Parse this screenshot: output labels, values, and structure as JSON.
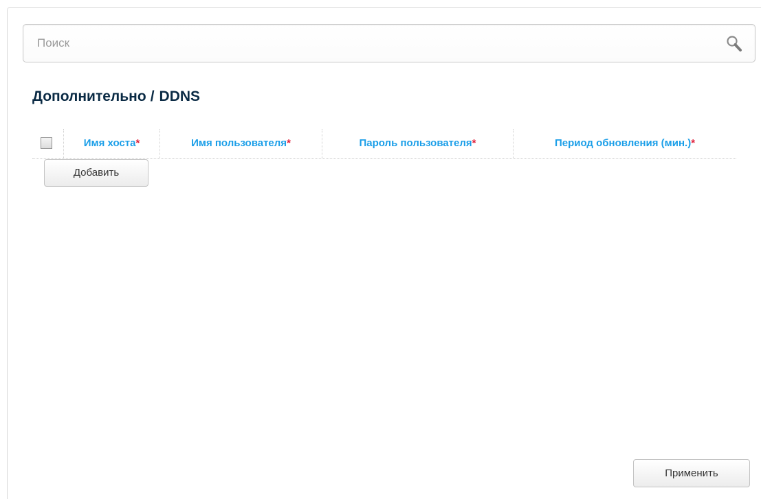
{
  "search": {
    "placeholder": "Поиск",
    "value": ""
  },
  "page": {
    "breadcrumb_parent": "Дополнительно",
    "separator": "/",
    "title": "DDNS"
  },
  "table": {
    "columns": [
      {
        "label": "Имя хоста",
        "required_mark": "*"
      },
      {
        "label": "Имя пользователя",
        "required_mark": "*"
      },
      {
        "label": "Пароль пользователя",
        "required_mark": "*"
      },
      {
        "label": "Период обновления (мин.)",
        "required_mark": "*"
      }
    ],
    "rows": []
  },
  "buttons": {
    "add_label": "Добавить",
    "apply_label": "Применить"
  },
  "colors": {
    "header_text": "#1a9ee8",
    "required_mark": "#e0203c",
    "title_text": "#0a2a44"
  },
  "icons": {
    "search": "search-icon"
  }
}
